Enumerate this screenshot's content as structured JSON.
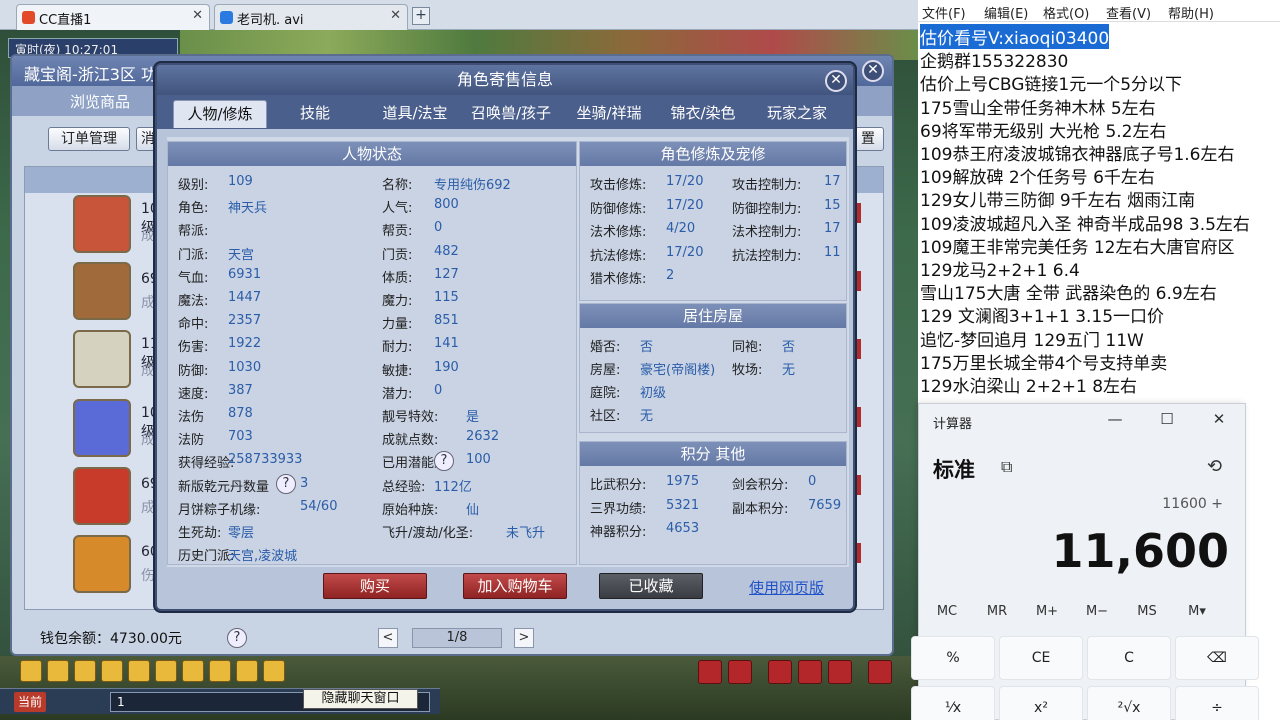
{
  "browser": {
    "tabs": [
      {
        "label": "CC直播1",
        "close": "✕"
      },
      {
        "label": "老司机. avi",
        "close": "✕"
      }
    ],
    "new_tab": "+"
  },
  "game": {
    "top_info": "寅时(夜)  10:27:01",
    "cbg": {
      "title": "藏宝阁-浙江3区 功夫熊猫",
      "close": "✕",
      "nav": [
        "浏览商品"
      ],
      "buttons": [
        "订单管理",
        "消",
        "置"
      ],
      "list": [
        {
          "lvl": "109级",
          "sub": "成就"
        },
        {
          "lvl": "69级",
          "sub": "成就"
        },
        {
          "lvl": "119级",
          "sub": "成长"
        },
        {
          "lvl": "109级",
          "sub": "成就"
        },
        {
          "lvl": "69级",
          "sub": "成就"
        },
        {
          "lvl": "60级",
          "sub": "伤害"
        }
      ],
      "wallet": "钱包余额：4730.00元",
      "help": "?",
      "pager": {
        "prev": "<",
        "page": "1/8",
        "next": ">"
      }
    },
    "dialog": {
      "title": "角色寄售信息",
      "close": "✕",
      "tabs": [
        "人物/修炼",
        "技能",
        "道具/法宝",
        "召唤兽/孩子",
        "坐骑/祥瑞",
        "锦衣/染色",
        "玩家之家"
      ],
      "status": {
        "header": "人物状态",
        "left": [
          {
            "k": "级别:",
            "v": "109"
          },
          {
            "k": "角色:",
            "v": "神天兵"
          },
          {
            "k": "帮派:",
            "v": ""
          },
          {
            "k": "门派:",
            "v": "天宫"
          },
          {
            "k": "气血:",
            "v": "6931"
          },
          {
            "k": "魔法:",
            "v": "1447"
          },
          {
            "k": "命中:",
            "v": "2357"
          },
          {
            "k": "伤害:",
            "v": "1922"
          },
          {
            "k": "防御:",
            "v": "1030"
          },
          {
            "k": "速度:",
            "v": "387"
          },
          {
            "k": "法伤",
            "v": "878"
          },
          {
            "k": "法防",
            "v": "703"
          },
          {
            "k": "获得经验:",
            "v": "258733933"
          },
          {
            "k": "新版乾元丹数量",
            "v": "3"
          },
          {
            "k": "月饼粽子机缘:",
            "v": "54/60"
          },
          {
            "k": "生死劫:",
            "v": "零层"
          },
          {
            "k": "历史门派:",
            "v": "天宫,凌波城"
          }
        ],
        "right": [
          {
            "k": "名称:",
            "v": "专用纯伤692"
          },
          {
            "k": "人气:",
            "v": "800"
          },
          {
            "k": "帮贡:",
            "v": "0"
          },
          {
            "k": "门贡:",
            "v": "482"
          },
          {
            "k": "体质:",
            "v": "127"
          },
          {
            "k": "魔力:",
            "v": "115"
          },
          {
            "k": "力量:",
            "v": "851"
          },
          {
            "k": "耐力:",
            "v": "141"
          },
          {
            "k": "敏捷:",
            "v": "190"
          },
          {
            "k": "潜力:",
            "v": "0"
          },
          {
            "k": "靓号特效:",
            "v": "是"
          },
          {
            "k": "成就点数:",
            "v": "2632"
          },
          {
            "k": "已用潜能果:",
            "v": "100"
          },
          {
            "k": "总经验:",
            "v": "112亿"
          },
          {
            "k": "原始种族:",
            "v": "仙"
          },
          {
            "k": "飞升/渡劫/化圣:",
            "v": "未飞升"
          }
        ]
      },
      "cultivation": {
        "header": "角色修炼及宠修",
        "left": [
          {
            "k": "攻击修炼:",
            "v": "17/20"
          },
          {
            "k": "防御修炼:",
            "v": "17/20"
          },
          {
            "k": "法术修炼:",
            "v": "4/20"
          },
          {
            "k": "抗法修炼:",
            "v": "17/20"
          },
          {
            "k": "猎术修炼:",
            "v": "2"
          }
        ],
        "right": [
          {
            "k": "攻击控制力:",
            "v": "17"
          },
          {
            "k": "防御控制力:",
            "v": "15"
          },
          {
            "k": "法术控制力:",
            "v": "17"
          },
          {
            "k": "抗法控制力:",
            "v": "11"
          }
        ]
      },
      "house": {
        "header": "居住房屋",
        "rows": [
          {
            "k": "婚否:",
            "v": "否"
          },
          {
            "k": "同袍:",
            "v": "否"
          },
          {
            "k": "房屋:",
            "v": "豪宅(帝阁楼)"
          },
          {
            "k": "牧场:",
            "v": "无"
          },
          {
            "k": "庭院:",
            "v": "初级"
          },
          {
            "k": "社区:",
            "v": "无"
          }
        ]
      },
      "score": {
        "header": "积分 其他",
        "rows": [
          {
            "k": "比武积分:",
            "v": "1975"
          },
          {
            "k": "剑会积分:",
            "v": "0"
          },
          {
            "k": "三界功绩:",
            "v": "5321"
          },
          {
            "k": "副本积分:",
            "v": "7659"
          },
          {
            "k": "神器积分:",
            "v": "4653"
          }
        ]
      },
      "buttons": {
        "buy": "购买",
        "cart": "加入购物车",
        "fav": "已收藏",
        "web": "使用网页版"
      },
      "help": "?"
    },
    "chat": {
      "current": "当前",
      "input": "1",
      "hide": "隐藏聊天窗口"
    }
  },
  "notepad": {
    "menu": [
      "文件(F)",
      "编辑(E)",
      "格式(O)",
      "查看(V)",
      "帮助(H)"
    ],
    "lines": [
      "估价看号V:xiaoqi03400",
      "企鹅群155322830",
      "估价上号CBG链接1元一个5分以下",
      "175雪山全带任务神木林 5左右",
      "69将军带无级别 大光枪 5.2左右",
      "109恭王府凌波城锦衣神器底子号1.6左右",
      "109解放碑 2个任务号 6千左右",
      "129女儿带三防御 9千左右 烟雨江南",
      "109凌波城超凡入圣 神奇半成品98 3.5左右",
      "109魔王非常完美任务 12左右大唐官府区",
      "129龙马2+2+1  6.4",
      "雪山175大唐 全带 武器染色的 6.9左右",
      "129 文澜阁3+1+1   3.15一口价",
      "追忆-梦回追月 129五门 11W",
      "175万里长城全带4个号支持单卖",
      "129水泊梁山 2+2+1 8左右"
    ]
  },
  "calculator": {
    "title": "计算器",
    "min": "—",
    "max": "☐",
    "close": "✕",
    "mode": "标准",
    "expression": "11600 +",
    "result": "11,600",
    "memory": [
      "MC",
      "MR",
      "M+",
      "M−",
      "MS",
      "M▾"
    ],
    "keys": [
      "%",
      "CE",
      "C",
      "⌫",
      "⅟x",
      "x²",
      "²√x",
      "÷"
    ]
  }
}
